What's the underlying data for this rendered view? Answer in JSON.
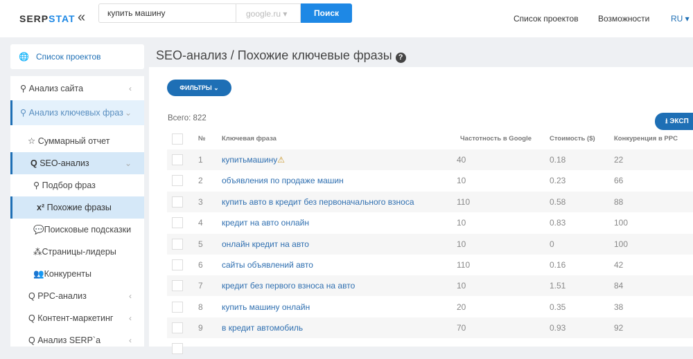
{
  "header": {
    "logo_a": "SERP",
    "logo_b": "STAT",
    "query": "купить машину",
    "engine": "google.ru",
    "search_button": "Поиск",
    "nav": [
      "Список проектов",
      "Возможности",
      "RU"
    ]
  },
  "sidebar": {
    "projects": "Список проектов",
    "items": [
      {
        "label": "Анализ сайта",
        "icon": "key-icon"
      },
      {
        "label": "Анализ ключевых фраз",
        "icon": "key-icon"
      },
      {
        "label": "Суммарный отчет",
        "icon": "star-icon"
      },
      {
        "label": "SEO-анализ",
        "icon": "search-icon"
      },
      {
        "label": "Подбор фраз",
        "icon": "key-icon"
      },
      {
        "label": "Похожие фразы",
        "icon": "x2-icon"
      },
      {
        "label": "Поисковые подсказки",
        "icon": "comments-icon"
      },
      {
        "label": "Страницы-лидеры",
        "icon": "sitemap-icon"
      },
      {
        "label": "Конкуренты",
        "icon": "users-icon"
      },
      {
        "label": "PPC-анализ",
        "icon": "search-icon"
      },
      {
        "label": "Контент-маркетинг",
        "icon": "search-icon"
      },
      {
        "label": "Анализ SERP`а",
        "icon": "search-icon"
      }
    ]
  },
  "main": {
    "title": "SEO-анализ / Похожие ключевые фразы",
    "filters": "ФИЛЬТРЫ",
    "total": "Всего: 822",
    "export": "ЭКСП",
    "columns": [
      "№",
      "Ключевая фраза",
      "Частотность в Google",
      "Стоимость ($)",
      "Конкуренция в PPC"
    ],
    "rows": [
      {
        "n": "1",
        "phrase": "купитьмашину",
        "freq": "40",
        "cost": "0.18",
        "comp": "22"
      },
      {
        "n": "2",
        "phrase": "объявления по продаже машин",
        "freq": "10",
        "cost": "0.23",
        "comp": "66"
      },
      {
        "n": "3",
        "phrase": "купить авто в кредит без первоначального взноса",
        "freq": "110",
        "cost": "0.58",
        "comp": "88"
      },
      {
        "n": "4",
        "phrase": "кредит на авто онлайн",
        "freq": "10",
        "cost": "0.83",
        "comp": "100"
      },
      {
        "n": "5",
        "phrase": "онлайн кредит на авто",
        "freq": "10",
        "cost": "0",
        "comp": "100"
      },
      {
        "n": "6",
        "phrase": "сайты объявлений авто",
        "freq": "110",
        "cost": "0.16",
        "comp": "42"
      },
      {
        "n": "7",
        "phrase": "кредит без первого взноса на авто",
        "freq": "10",
        "cost": "1.51",
        "comp": "84"
      },
      {
        "n": "8",
        "phrase": "купить машину онлайн",
        "freq": "20",
        "cost": "0.35",
        "comp": "38"
      },
      {
        "n": "9",
        "phrase": "в кредит автомобиль",
        "freq": "70",
        "cost": "0.93",
        "comp": "92"
      }
    ]
  }
}
